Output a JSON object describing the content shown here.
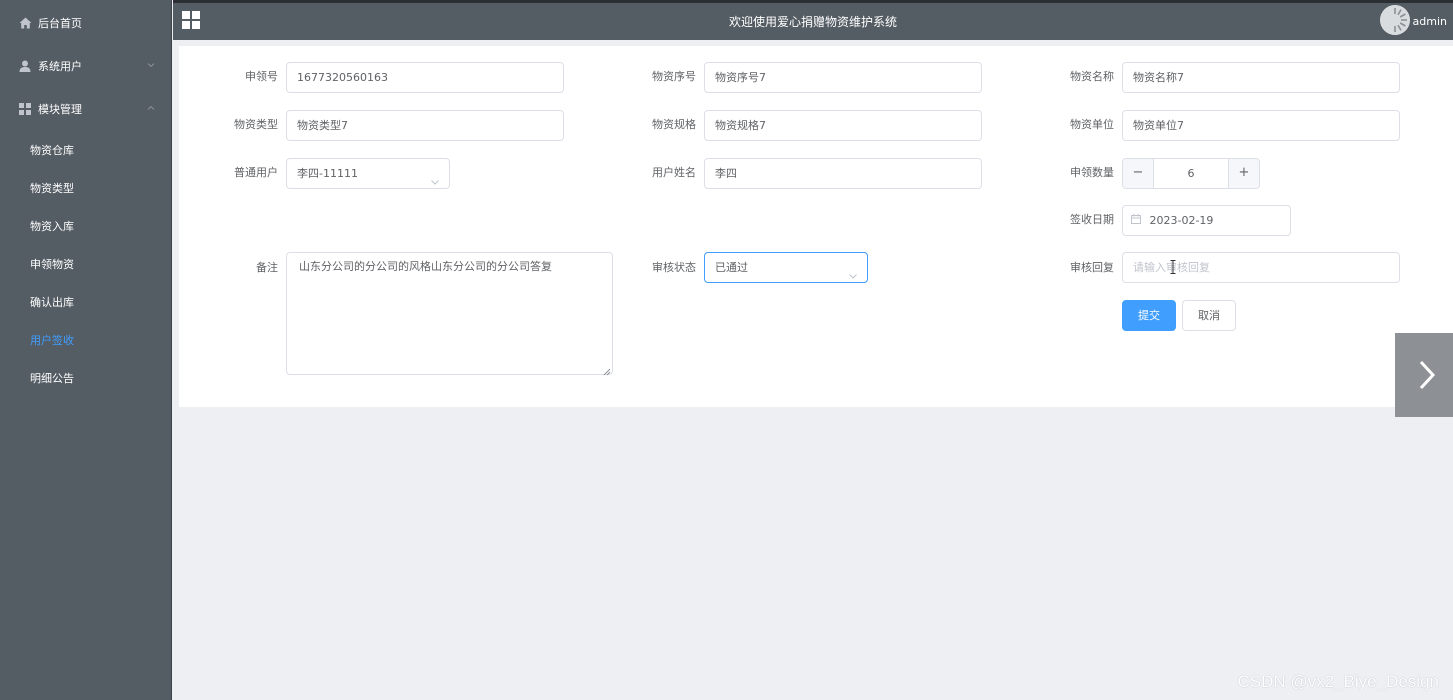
{
  "sidebar": {
    "home": "后台首页",
    "system_users": "系统用户",
    "module_mgmt": "模块管理",
    "submenu": [
      {
        "label": "物资仓库"
      },
      {
        "label": "物资类型"
      },
      {
        "label": "物资入库"
      },
      {
        "label": "申领物资"
      },
      {
        "label": "确认出库"
      },
      {
        "label": "用户签收",
        "active": true
      },
      {
        "label": "明细公告"
      }
    ]
  },
  "header": {
    "title": "欢迎使用爱心捐赠物资维护系统",
    "user": "admin"
  },
  "form": {
    "apply_no": {
      "label": "申领号",
      "value": "1677320560163"
    },
    "item_no": {
      "label": "物资序号",
      "value": "物资序号7"
    },
    "item_name": {
      "label": "物资名称",
      "value": "物资名称7"
    },
    "item_type": {
      "label": "物资类型",
      "value": "物资类型7"
    },
    "item_spec": {
      "label": "物资规格",
      "value": "物资规格7"
    },
    "item_unit": {
      "label": "物资单位",
      "value": "物资单位7"
    },
    "normal_user": {
      "label": "普通用户",
      "value": "李四-11111"
    },
    "user_name": {
      "label": "用户姓名",
      "value": "李四"
    },
    "apply_qty": {
      "label": "申领数量",
      "value": "6",
      "minus": "−",
      "plus": "+"
    },
    "sign_date": {
      "label": "签收日期",
      "value": "2023-02-19"
    },
    "remark": {
      "label": "备注",
      "value": "山东分公司的分公司的风格山东分公司的分公司答复"
    },
    "review_status": {
      "label": "审核状态",
      "value": "已通过"
    },
    "review_reply": {
      "label": "审核回复",
      "placeholder": "请输入审核回复"
    },
    "submit": "提交",
    "cancel": "取消"
  },
  "watermark": "CSDN @vx2_Biye_Design",
  "colors": {
    "sidebar_bg": "#545c64",
    "accent": "#409eff",
    "page_bg": "#eeeff3"
  }
}
